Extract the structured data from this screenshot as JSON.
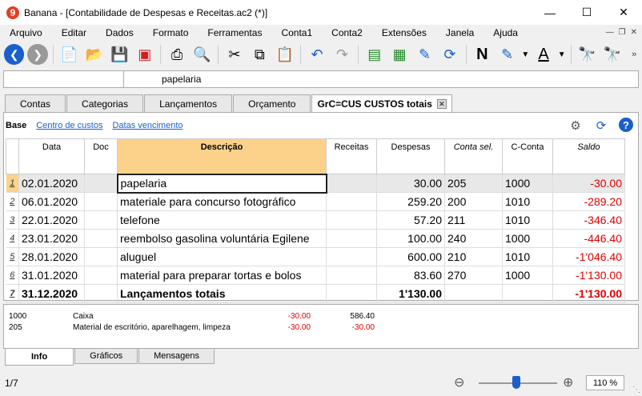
{
  "window": {
    "title": "Banana - [Contabilidade de Despesas e Receitas.ac2 (*)]",
    "logo": "9"
  },
  "menu": [
    "Arquivo",
    "Editar",
    "Dados",
    "Formato",
    "Ferramentas",
    "Conta1",
    "Conta2",
    "Extensões",
    "Janela",
    "Ajuda"
  ],
  "formula_bar": {
    "text": "papelaria"
  },
  "tabs": [
    "Contas",
    "Categorias",
    "Lançamentos",
    "Orçamento",
    "GrC=CUS CUSTOS totais"
  ],
  "views": [
    "Base",
    "Centro de custos",
    "Datas vencimento"
  ],
  "columns": [
    "Data",
    "Doc",
    "Descrição",
    "Receitas",
    "Despesas",
    "Conta sel.",
    "C-Conta",
    "Saldo"
  ],
  "rows": [
    {
      "n": "1",
      "data": "02.01.2020",
      "doc": "",
      "desc": "papelaria",
      "receitas": "",
      "despesas": "30.00",
      "conta": "205",
      "cconta": "1000",
      "saldo": "-30.00"
    },
    {
      "n": "2",
      "data": "06.01.2020",
      "doc": "",
      "desc": "materiale para concurso fotográfico",
      "receitas": "",
      "despesas": "259.20",
      "conta": "200",
      "cconta": "1010",
      "saldo": "-289.20"
    },
    {
      "n": "3",
      "data": "22.01.2020",
      "doc": "",
      "desc": "telefone",
      "receitas": "",
      "despesas": "57.20",
      "conta": "211",
      "cconta": "1010",
      "saldo": "-346.40"
    },
    {
      "n": "4",
      "data": "23.01.2020",
      "doc": "",
      "desc": "reembolso gasolina voluntária Egilene",
      "receitas": "",
      "despesas": "100.00",
      "conta": "240",
      "cconta": "1000",
      "saldo": "-446.40"
    },
    {
      "n": "5",
      "data": "28.01.2020",
      "doc": "",
      "desc": "aluguel",
      "receitas": "",
      "despesas": "600.00",
      "conta": "210",
      "cconta": "1010",
      "saldo": "-1'046.40"
    },
    {
      "n": "6",
      "data": "31.01.2020",
      "doc": "",
      "desc": "material para preparar tortas e bolos",
      "receitas": "",
      "despesas": "83.60",
      "conta": "270",
      "cconta": "1000",
      "saldo": "-1'130.00"
    },
    {
      "n": "7",
      "data": "31.12.2020",
      "doc": "",
      "desc": "Lançamentos totais",
      "receitas": "",
      "despesas": "1'130.00",
      "conta": "",
      "cconta": "",
      "saldo": "-1'130.00"
    }
  ],
  "info_lines": [
    {
      "account": "1000",
      "name": "Caixa",
      "amount": "-30.00",
      "balance": "586.40"
    },
    {
      "account": "205",
      "name": "Material de escritório, aparelhagem, limpeza",
      "amount": "-30.00",
      "balance": "-30.00"
    }
  ],
  "bottom_tabs": [
    "Info",
    "Gráficos",
    "Mensagens"
  ],
  "status": {
    "row_position": "1/7",
    "zoom": "110 %",
    "zoom_level_fraction": 0.48
  },
  "colors": {
    "accent": "#1a5fcc",
    "header_highlight": "#fcd28a",
    "negative": "#e00000"
  }
}
